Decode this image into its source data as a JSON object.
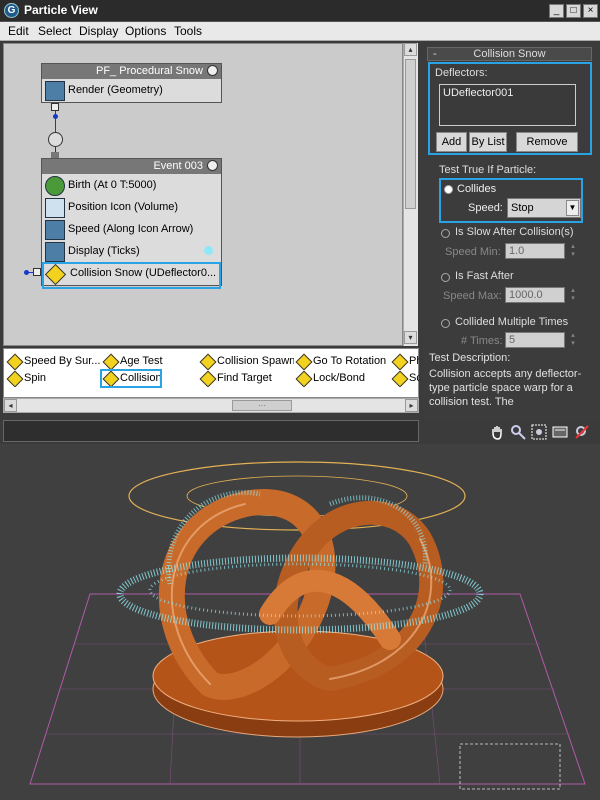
{
  "window": {
    "title": "Particle View",
    "min": "_",
    "max": "□",
    "close": "×",
    "logo": "G"
  },
  "menu": [
    "Edit",
    "Select",
    "Display",
    "Options",
    "Tools"
  ],
  "graph": {
    "pf_node": {
      "title": "PF_ Procedural Snow",
      "rows": [
        "Render (Geometry)"
      ]
    },
    "event_node": {
      "title": "Event 003",
      "rows": [
        "Birth  (At 0 T:5000)",
        "Position Icon (Volume)",
        "Speed  (Along Icon Arrow)",
        "Display  (Ticks)",
        "Collision Snow (UDeflector0..."
      ]
    }
  },
  "panel": {
    "rollout_title": "Collision Snow",
    "rollout_toggle": "-",
    "deflectors_label": "Deflectors:",
    "deflectors": [
      "UDeflector001"
    ],
    "add": "Add",
    "by_list": "By List",
    "remove": "Remove",
    "test_label": "Test True If Particle:",
    "collides": "Collides",
    "speed_label": "Speed:",
    "speed_value": "Stop",
    "is_slow": "Is Slow After Collision(s)",
    "speed_min_label": "Speed Min:",
    "speed_min": "1.0",
    "is_fast": "Is Fast After",
    "speed_max_label": "Speed Max:",
    "speed_max": "1000.0",
    "collided_multiple": "Collided Multiple Times",
    "times_label": "# Times:",
    "times": "5"
  },
  "depot": {
    "row1": [
      "Speed By Sur...",
      "Age Test",
      "Collision Spawn",
      "Go To Rotation",
      "Ph"
    ],
    "row2": [
      "Spin",
      "Collision",
      "Find Target",
      "Lock/Bond",
      "Sc"
    ]
  },
  "scroll": {
    "left": "◂",
    "right": "▸",
    "up": "▴",
    "down": "▾",
    "grip": "···"
  },
  "description": {
    "heading": "Test Description:",
    "text": "Collision accepts any deflector-type particle space warp for a collision test. The"
  },
  "colors": {
    "highlight": "#2aa2e6",
    "mesh": "#c86a2a",
    "particles": "#8fe6f0"
  }
}
